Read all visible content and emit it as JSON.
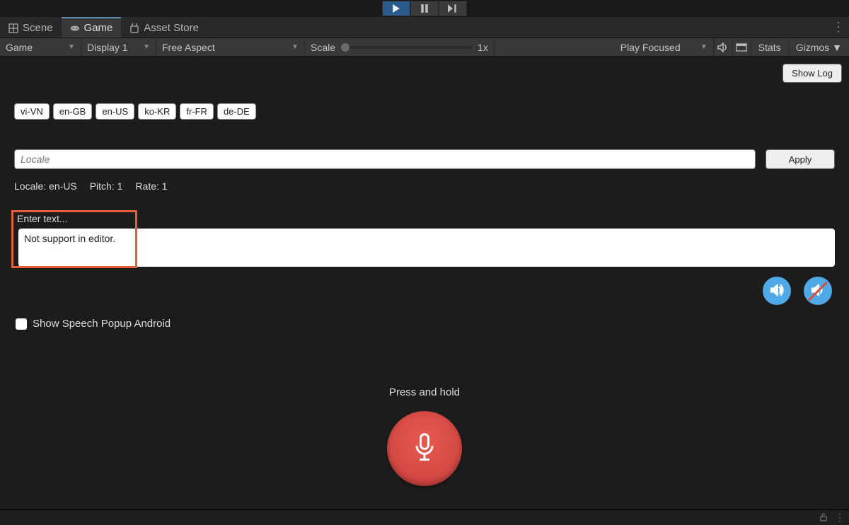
{
  "playbar": {
    "play_active": true
  },
  "tabs": {
    "scene": "Scene",
    "game": "Game",
    "asset_store": "Asset Store",
    "active": "game"
  },
  "options": {
    "view": "Game",
    "display": "Display 1",
    "aspect": "Free Aspect",
    "scale_label": "Scale",
    "scale_value": "1x",
    "play_mode": "Play Focused",
    "stats": "Stats",
    "gizmos": "Gizmos"
  },
  "ui": {
    "show_log": "Show Log",
    "languages": [
      "vi-VN",
      "en-GB",
      "en-US",
      "ko-KR",
      "fr-FR",
      "de-DE"
    ],
    "locale_placeholder": "Locale",
    "apply": "Apply",
    "status": {
      "locale": "Locale: en-US",
      "pitch": "Pitch: 1",
      "rate": "Rate: 1"
    },
    "enter_label": "Enter text...",
    "text_value": "Not support in editor.",
    "checkbox_label": "Show Speech Popup Android",
    "press_hold": "Press and hold"
  }
}
